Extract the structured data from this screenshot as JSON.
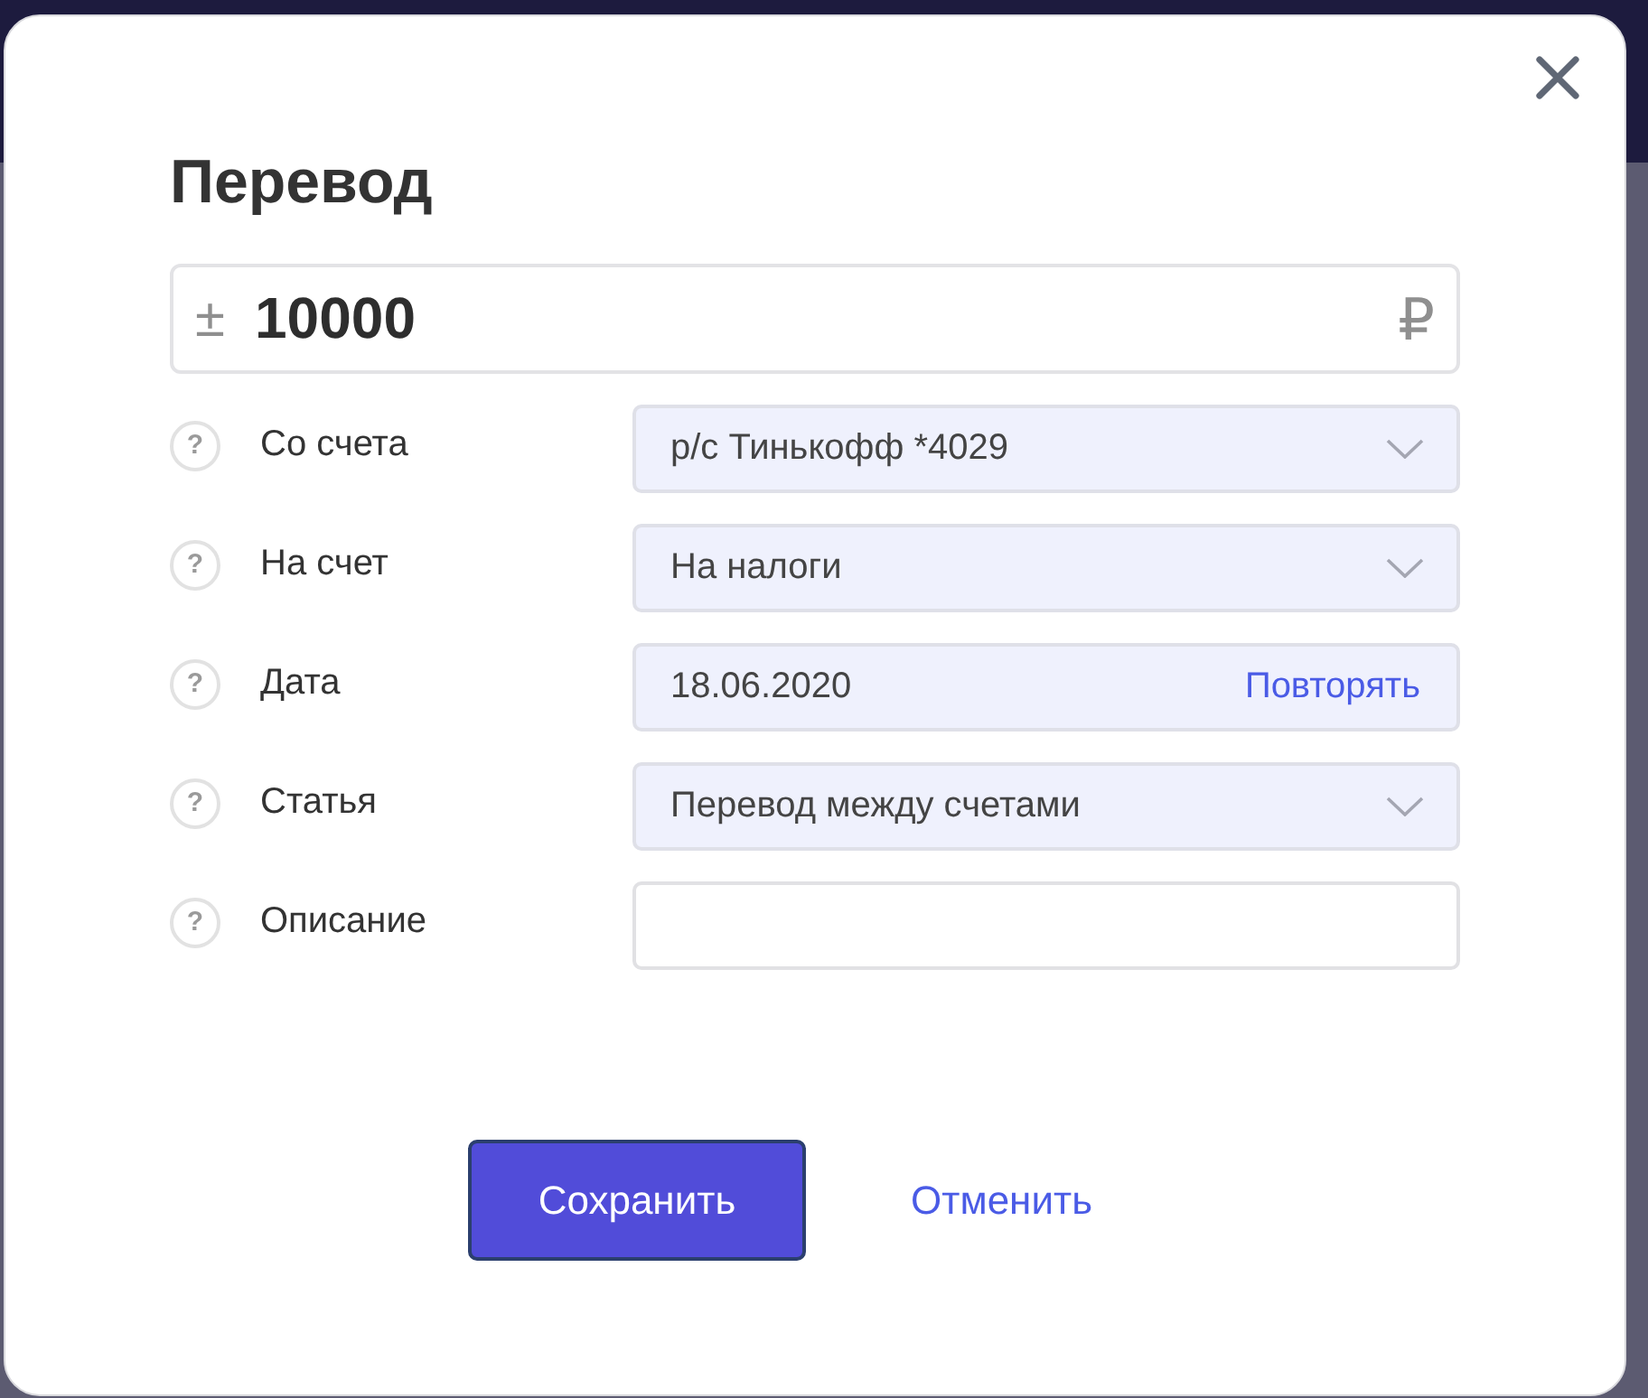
{
  "dialog": {
    "title": "Перевод",
    "amount": {
      "sign": "±",
      "value": "10000",
      "currency": "₽"
    },
    "fields": [
      {
        "kind": "select",
        "hint_icon": "?",
        "label": "Со счета",
        "value": "р/с Тинькофф *4029"
      },
      {
        "kind": "select",
        "hint_icon": "?",
        "label": "На счет",
        "value": "На налоги"
      },
      {
        "kind": "date",
        "hint_icon": "?",
        "label": "Дата",
        "value": "18.06.2020",
        "action": "Повторять"
      },
      {
        "kind": "select",
        "hint_icon": "?",
        "label": "Статья",
        "value": "Перевод между счетами"
      },
      {
        "kind": "text",
        "hint_icon": "?",
        "label": "Описание"
      }
    ],
    "buttons": [
      {
        "kind": "primary",
        "label": "Сохранить"
      },
      {
        "kind": "link",
        "label": "Отменить"
      }
    ]
  }
}
